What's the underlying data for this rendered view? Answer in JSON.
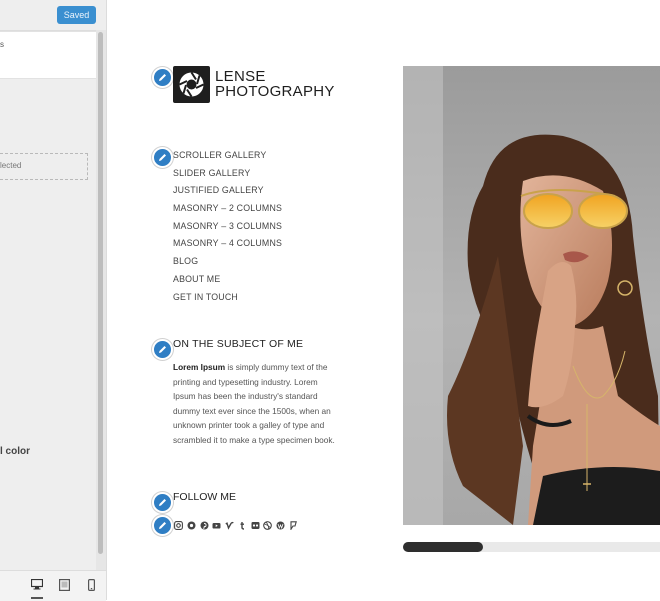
{
  "panel": {
    "saved_label": "Saved",
    "box_text": "s",
    "dashed_text": "lected",
    "color_label": "l color"
  },
  "site": {
    "brand_line1": "LENSE",
    "brand_line2": "PHOTOGRAPHY",
    "nav": [
      "SCROLLER GALLERY",
      "SLIDER GALLERY",
      "JUSTIFIED GALLERY",
      "MASONRY – 2 COLUMNS",
      "MASONRY – 3 COLUMNS",
      "MASONRY – 4 COLUMNS",
      "BLOG",
      "ABOUT ME",
      "GET IN TOUCH"
    ],
    "about_heading": "ON THE SUBJECT OF ME",
    "about_bold": "Lorem Ipsum",
    "about_text": " is simply dummy text of the printing and typesetting industry. Lorem Ipsum has been the industry's standard dummy text ever since the 1500s, when an unknown printer took a galley of type and scrambled it to make a type specimen book.",
    "follow_heading": "FOLLOW ME",
    "socials": [
      "instagram-icon",
      "circle-icon",
      "pinterest-icon",
      "youtube-icon",
      "vimeo-icon",
      "tumblr-icon",
      "flickr-icon",
      "dribbble-icon",
      "wordpress-icon",
      "foursquare-icon"
    ]
  },
  "slider": {
    "progress": 0.31
  },
  "colors": {
    "accent": "#2f7ec4",
    "saved": "#3a8fd0",
    "dark": "#1e1e1e"
  }
}
